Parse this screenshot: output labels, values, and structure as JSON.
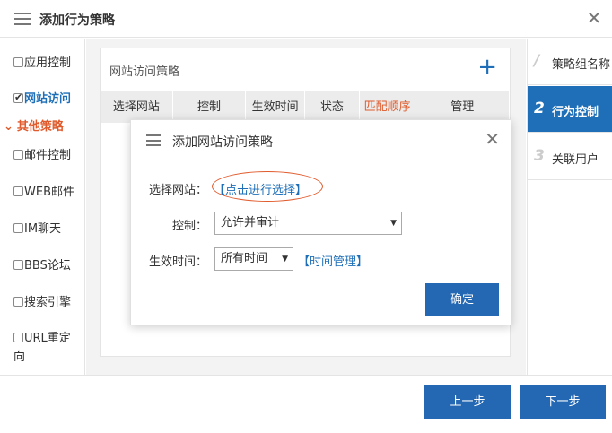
{
  "window": {
    "title": "添加行为策略"
  },
  "sidebar": {
    "items": [
      {
        "label": "应用控制",
        "checked": false
      },
      {
        "label": "网站访问",
        "checked": true
      },
      {
        "label": "邮件控制",
        "checked": false
      },
      {
        "label": "WEB邮件",
        "checked": false
      },
      {
        "label": "IM聊天",
        "checked": false
      },
      {
        "label": "BBS论坛",
        "checked": false
      },
      {
        "label": "搜索引擎",
        "checked": false
      },
      {
        "label": "URL重定",
        "label2": "向",
        "checked": false
      }
    ],
    "section_label": "其他策略"
  },
  "panel": {
    "title": "网站访问策略",
    "add_glyph": "+",
    "columns": [
      "选择网站",
      "控制",
      "生效时间",
      "状态",
      "匹配顺序",
      "管理"
    ]
  },
  "steps": [
    {
      "num": "/",
      "label": "策略组名称"
    },
    {
      "num": "2",
      "label": "行为控制"
    },
    {
      "num": "3",
      "label": "关联用户"
    }
  ],
  "footer": {
    "prev_label": "上一步",
    "next_label": "下一步"
  },
  "dialog": {
    "title": "添加网站访问策略",
    "select_site_label": "选择网站：",
    "select_site_link": "【点击进行选择】",
    "control_label": "控制：",
    "control_value": "允许并审计",
    "time_label": "生效时间：",
    "time_value": "所有时间",
    "time_manage_link": "【时间管理】",
    "confirm_label": "确定"
  },
  "colors": {
    "accent": "#2468b3",
    "highlight": "#e05a2b"
  }
}
